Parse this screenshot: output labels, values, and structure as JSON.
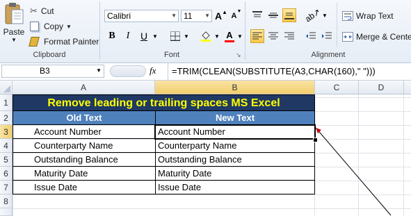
{
  "ribbon": {
    "clipboard": {
      "paste_label": "Paste",
      "cut_label": "Cut",
      "copy_label": "Copy",
      "format_painter_label": "Format Painter",
      "group_label": "Clipboard"
    },
    "font": {
      "font_name": "Calibri",
      "font_size": "11",
      "bold": "B",
      "italic": "I",
      "underline": "U",
      "grow": "A",
      "shrink": "A",
      "font_color": "A",
      "group_label": "Font"
    },
    "alignment": {
      "wrap_text_label": "Wrap Text",
      "merge_label": "Merge & Center",
      "group_label": "Alignment"
    }
  },
  "formula_bar": {
    "name_box": "B3",
    "fx": "fx",
    "formula": "=TRIM(CLEAN(SUBSTITUTE(A3,CHAR(160),\" \")))"
  },
  "sheet": {
    "columns": [
      "A",
      "B",
      "C",
      "D"
    ],
    "rows": [
      "1",
      "2",
      "3",
      "4",
      "5",
      "6",
      "7",
      "8"
    ],
    "title": "Remove leading or trailing spaces MS Excel",
    "header_old": "Old Text",
    "header_new": "New Text",
    "old_values": [
      "Account Number",
      "Counterparty Name",
      "Outstanding Balance",
      "Maturity Date",
      "Issue Date"
    ],
    "new_values": [
      "Account Number",
      "Counterparty Name",
      "Outstanding Balance",
      "Maturity Date",
      "Issue Date"
    ]
  },
  "colors": {
    "title_bg": "#1f3864",
    "title_text": "#ffff00",
    "header_bg": "#4f81bd",
    "header_text": "#ffffff"
  }
}
